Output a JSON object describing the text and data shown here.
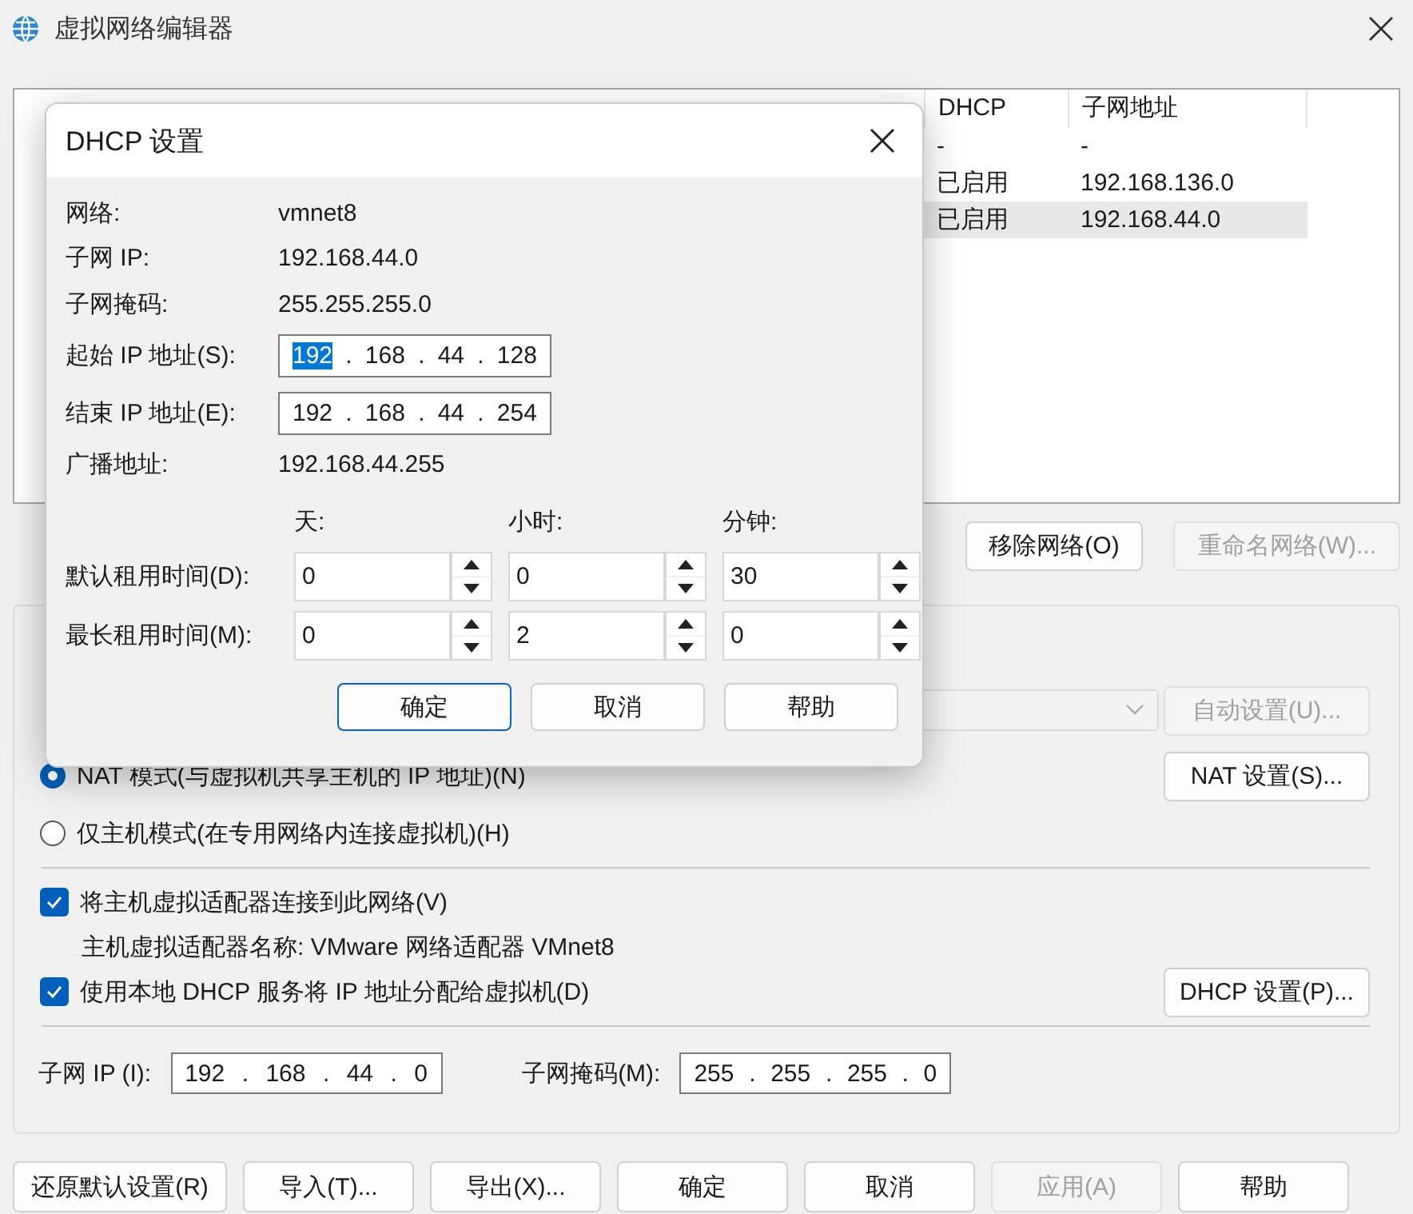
{
  "window": {
    "title": "虚拟网络编辑器"
  },
  "network_table": {
    "columns": [
      {
        "label": "DHCP"
      },
      {
        "label": "子网地址"
      }
    ],
    "rows": [
      {
        "cells": [
          "-",
          "-"
        ],
        "selected": false
      },
      {
        "cells": [
          "已启用",
          "192.168.136.0"
        ],
        "selected": false
      },
      {
        "cells": [
          "已启用",
          "192.168.44.0"
        ],
        "selected": true
      }
    ]
  },
  "table_buttons": [
    {
      "label": "移除网络(O)",
      "disabled": false
    },
    {
      "label": "重命名网络(W)...",
      "disabled": true
    }
  ],
  "vmnet_settings": {
    "items": [
      {
        "kind": "select",
        "disabled": true,
        "button": {
          "label": "自动设置(U)...",
          "disabled": true
        }
      },
      {
        "kind": "radio",
        "label": "NAT 模式(与虚拟机共享主机的 IP 地址)(N)",
        "selected": true,
        "button": {
          "label": "NAT 设置(S)...",
          "disabled": false
        }
      },
      {
        "kind": "radio",
        "label": "仅主机模式(在专用网络内连接虚拟机)(H)",
        "selected": false
      },
      {
        "kind": "divider"
      },
      {
        "kind": "checkbox",
        "label": "将主机虚拟适配器连接到此网络(V)",
        "checked": true
      },
      {
        "kind": "note",
        "text": "主机虚拟适配器名称: VMware 网络适配器 VMnet8"
      },
      {
        "kind": "checkbox",
        "label": "使用本地 DHCP 服务将 IP 地址分配给虚拟机(D)",
        "checked": true,
        "button": {
          "label": "DHCP 设置(P)...",
          "disabled": false
        }
      },
      {
        "kind": "divider"
      },
      {
        "kind": "subnet",
        "separator": ".",
        "fields": [
          {
            "label": "子网 IP (I):",
            "octets": [
              "192",
              "168",
              "44",
              "0"
            ]
          },
          {
            "label": "子网掩码(M):",
            "octets": [
              "255",
              "255",
              "255",
              "0"
            ]
          }
        ]
      }
    ]
  },
  "bottom_buttons": [
    {
      "label": "还原默认设置(R)",
      "disabled": false
    },
    {
      "label": "导入(T)...",
      "disabled": false
    },
    {
      "label": "导出(X)...",
      "disabled": false
    },
    {
      "label": "确定",
      "disabled": false
    },
    {
      "label": "取消",
      "disabled": false
    },
    {
      "label": "应用(A)",
      "disabled": true
    },
    {
      "label": "帮助",
      "disabled": false
    }
  ],
  "dhcp_dialog": {
    "title": "DHCP 设置",
    "info": [
      {
        "kind": "text",
        "label": "网络:",
        "value": "vmnet8"
      },
      {
        "kind": "text",
        "label": "子网 IP:",
        "value": "192.168.44.0"
      },
      {
        "kind": "text",
        "label": "子网掩码:",
        "value": "255.255.255.0"
      },
      {
        "kind": "ip",
        "label": "起始 IP 地址(S):",
        "separator": ".",
        "octets": [
          {
            "text": "192",
            "selected": true
          },
          {
            "text": "168",
            "selected": false
          },
          {
            "text": "44",
            "selected": false
          },
          {
            "text": "128",
            "selected": false
          }
        ]
      },
      {
        "kind": "ip",
        "label": "结束 IP 地址(E):",
        "separator": ".",
        "octets": [
          {
            "text": "192",
            "selected": false
          },
          {
            "text": "168",
            "selected": false
          },
          {
            "text": "44",
            "selected": false
          },
          {
            "text": "254",
            "selected": false
          }
        ]
      },
      {
        "kind": "text",
        "label": "广播地址:",
        "value": "192.168.44.255"
      }
    ],
    "lease": {
      "units": [
        "天:",
        "小时:",
        "分钟:"
      ],
      "rows": [
        {
          "label": "默认租用时间(D):",
          "values": [
            "0",
            "0",
            "30"
          ]
        },
        {
          "label": "最长租用时间(M):",
          "values": [
            "0",
            "2",
            "0"
          ]
        }
      ]
    },
    "buttons": [
      {
        "label": "确定",
        "focused": true
      },
      {
        "label": "取消",
        "focused": false
      },
      {
        "label": "帮助",
        "focused": false
      }
    ]
  }
}
